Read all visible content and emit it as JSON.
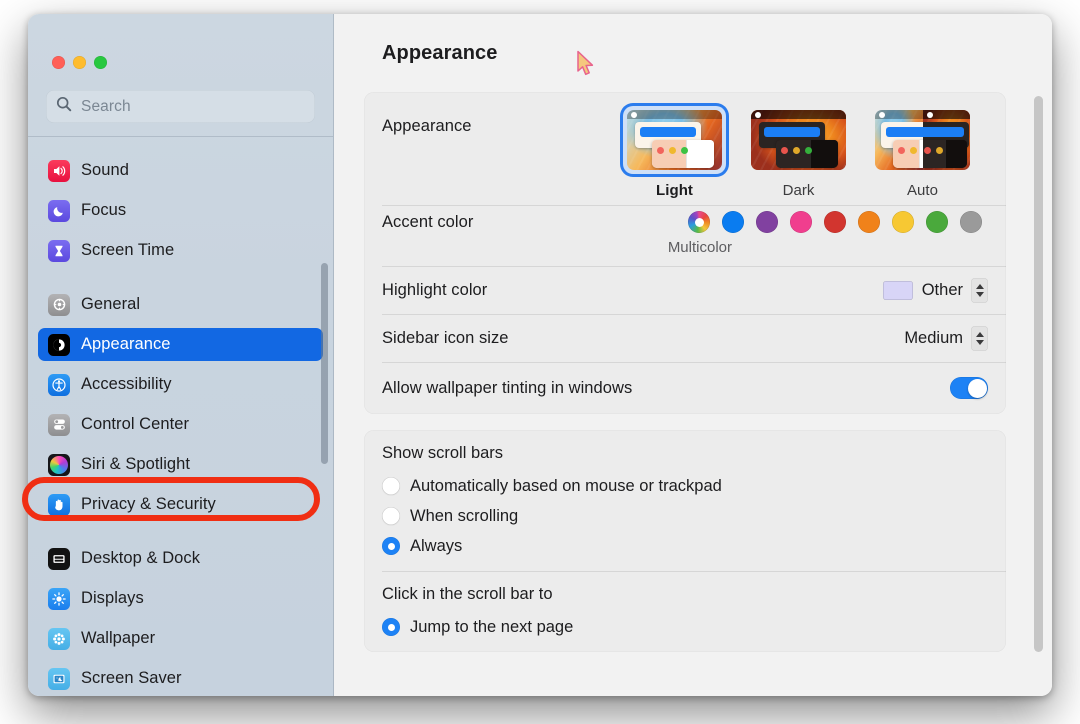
{
  "window": {
    "title": "Appearance",
    "traffic_lights": [
      "close",
      "minimize",
      "zoom"
    ]
  },
  "sidebar": {
    "search": {
      "placeholder": "Search",
      "value": "",
      "icon": "search-icon"
    },
    "items": [
      {
        "label": "Sound",
        "icon": "sound-icon",
        "selected": false,
        "clipped": true
      },
      {
        "label": "Focus",
        "icon": "focus-icon",
        "selected": false
      },
      {
        "label": "Screen Time",
        "icon": "screen-time-icon",
        "selected": false
      },
      {
        "label": "General",
        "icon": "general-icon",
        "selected": false,
        "gap_before": true
      },
      {
        "label": "Appearance",
        "icon": "appearance-icon",
        "selected": true
      },
      {
        "label": "Accessibility",
        "icon": "accessibility-icon",
        "selected": false
      },
      {
        "label": "Control Center",
        "icon": "control-center-icon",
        "selected": false
      },
      {
        "label": "Siri & Spotlight",
        "icon": "siri-icon",
        "selected": false
      },
      {
        "label": "Privacy & Security",
        "icon": "privacy-icon",
        "selected": false,
        "annotated": true
      },
      {
        "label": "Desktop & Dock",
        "icon": "desktop-dock-icon",
        "selected": false,
        "gap_before": true
      },
      {
        "label": "Displays",
        "icon": "displays-icon",
        "selected": false
      },
      {
        "label": "Wallpaper",
        "icon": "wallpaper-icon",
        "selected": false
      },
      {
        "label": "Screen Saver",
        "icon": "screen-saver-icon",
        "selected": false
      }
    ]
  },
  "main": {
    "appearance": {
      "label": "Appearance",
      "options": [
        {
          "caption": "Light",
          "selected": true
        },
        {
          "caption": "Dark",
          "selected": false
        },
        {
          "caption": "Auto",
          "selected": false
        }
      ]
    },
    "accent_color": {
      "label": "Accent color",
      "selected_name": "Multicolor",
      "swatches": [
        {
          "name": "Multicolor",
          "color": "multicolor"
        },
        {
          "name": "Blue",
          "color": "#0a7cf0"
        },
        {
          "name": "Purple",
          "color": "#8141a0"
        },
        {
          "name": "Pink",
          "color": "#f03e8e"
        },
        {
          "name": "Red",
          "color": "#d2352f"
        },
        {
          "name": "Orange",
          "color": "#f0821a"
        },
        {
          "name": "Yellow",
          "color": "#f7c833"
        },
        {
          "name": "Green",
          "color": "#4aa93c"
        },
        {
          "name": "Graphite",
          "color": "#9a9a9a"
        }
      ]
    },
    "highlight_color": {
      "label": "Highlight color",
      "value": "Other",
      "swatch": "#d8d5f7"
    },
    "sidebar_icon_size": {
      "label": "Sidebar icon size",
      "value": "Medium"
    },
    "wallpaper_tinting": {
      "label": "Allow wallpaper tinting in windows",
      "enabled": true
    },
    "show_scroll_bars": {
      "title": "Show scroll bars",
      "options": [
        {
          "label": "Automatically based on mouse or trackpad",
          "selected": false
        },
        {
          "label": "When scrolling",
          "selected": false
        },
        {
          "label": "Always",
          "selected": true
        }
      ]
    },
    "click_scroll_bar": {
      "title": "Click in the scroll bar to",
      "options": [
        {
          "label": "Jump to the next page",
          "selected": true
        }
      ]
    }
  },
  "annotation": {
    "color": "#f02e13",
    "target": "Privacy & Security"
  },
  "cursor": {
    "icon": "arrow-pointer"
  }
}
